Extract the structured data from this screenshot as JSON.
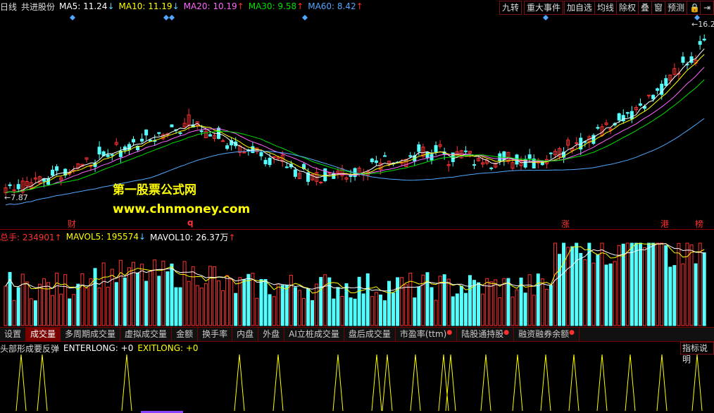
{
  "main_header": {
    "period": "日线",
    "stock": "共进股份",
    "ma5_label": "MA5: 11.24",
    "ma10_label": "MA10: 11.19",
    "ma20_label": "MA20: 10.19",
    "ma30_label": "MA30: 9.58",
    "ma60_label": "MA60: 8.42"
  },
  "right_buttons": [
    "九转",
    "重大事件",
    "加自选",
    "均线",
    "除权",
    "叠",
    "窗",
    "预测"
  ],
  "price_labels": {
    "high": "16.2",
    "low": "7.87"
  },
  "watermark": {
    "line1": "第一股票公式网",
    "line2": "www.chnmoney.com"
  },
  "event_markers": [
    "财",
    "q",
    "涨",
    "港",
    "榜"
  ],
  "vol_header": {
    "total": "总手: 234901",
    "mavol5": "MAVOL5: 195574",
    "mavol10": "MAVOL10: 26.37万"
  },
  "tabs": [
    {
      "label": "设置",
      "active": false,
      "dot": false
    },
    {
      "label": "成交量",
      "active": true,
      "dot": false
    },
    {
      "label": "多周期成交量",
      "active": false,
      "dot": false
    },
    {
      "label": "虚拟成交量",
      "active": false,
      "dot": false
    },
    {
      "label": "金额",
      "active": false,
      "dot": false
    },
    {
      "label": "换手率",
      "active": false,
      "dot": false
    },
    {
      "label": "内盘",
      "active": false,
      "dot": false
    },
    {
      "label": "外盘",
      "active": false,
      "dot": false
    },
    {
      "label": "AI立桩成交量",
      "active": false,
      "dot": false
    },
    {
      "label": "盘后成交量",
      "active": false,
      "dot": false
    },
    {
      "label": "市盈率(ttm)",
      "active": false,
      "dot": true
    },
    {
      "label": "陆股通持股",
      "active": false,
      "dot": true
    },
    {
      "label": "融资融券余额",
      "active": false,
      "dot": true
    }
  ],
  "indicator": {
    "name": "头部形成要反弹",
    "enterlong": "ENTERLONG: +0",
    "exitlong": "EXITLONG: +0",
    "help_button": "指标说明"
  },
  "colors": {
    "up": "#ff3030",
    "down": "#54ffff",
    "ma5": "#ffffff",
    "ma10": "#ffff00",
    "ma20": "#ff66ff",
    "ma30": "#00e000",
    "ma60": "#4fa8ff",
    "signal": "#ffff00",
    "border": "#8a0000"
  }
}
